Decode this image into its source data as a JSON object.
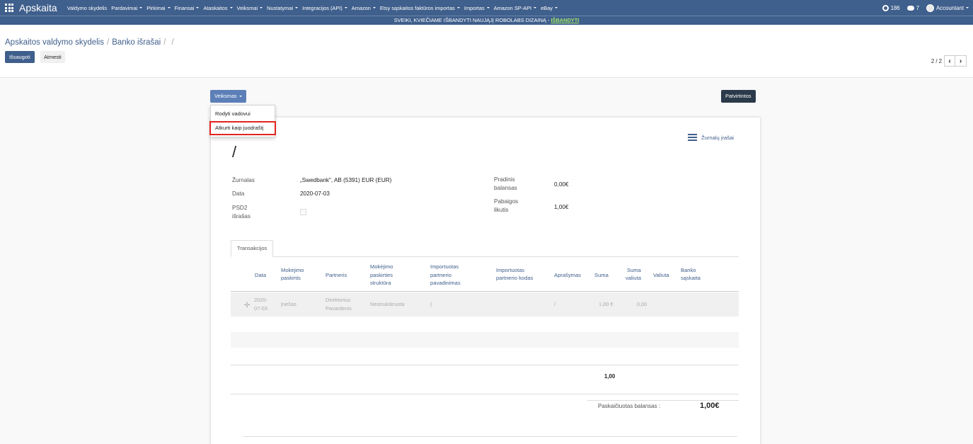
{
  "navbar": {
    "brand": "Apskaita",
    "menu": [
      {
        "label": "Valdymo skydelis",
        "dropdown": false
      },
      {
        "label": "Pardavimai",
        "dropdown": true
      },
      {
        "label": "Pirkimai",
        "dropdown": true
      },
      {
        "label": "Finansai",
        "dropdown": true
      },
      {
        "label": "Ataskaitos",
        "dropdown": true
      },
      {
        "label": "Veiksmai",
        "dropdown": true
      },
      {
        "label": "Nustatymai",
        "dropdown": true
      },
      {
        "label": "Integracijos (API)",
        "dropdown": true
      },
      {
        "label": "Amazon",
        "dropdown": true
      },
      {
        "label": "Etsy sąskaitos faktūros importas",
        "dropdown": true
      },
      {
        "label": "Importas",
        "dropdown": true
      },
      {
        "label": "Amazon SP-API",
        "dropdown": true
      },
      {
        "label": "eBay",
        "dropdown": true
      }
    ],
    "activity_count": "186",
    "message_count": "7",
    "user": "Accountant"
  },
  "banner": {
    "text": "SVEIKI, KVIEČIAME IŠBANDYTI NAUJĄJĮ ROBOLABS DIZAINĄ - ",
    "link": "IŠBANDYTI"
  },
  "breadcrumb": {
    "items": [
      "Apskaitos valdymo skydelis",
      "Banko išrašai"
    ],
    "separator": "/"
  },
  "buttons": {
    "save": "Išsaugoti",
    "discard": "Atmesti",
    "action": "Veiksmas",
    "confirmed": "Patvirtintos"
  },
  "pager": {
    "text": "2 / 2",
    "prev": "‹",
    "next": "›"
  },
  "dropdown": {
    "items": [
      "Rodyti vadovui",
      "Atkurti kaip juodraštį"
    ]
  },
  "sheet": {
    "journal_link": "Žurnalų įrašai",
    "title": "/",
    "fields": {
      "zurnalas_label": "Žurnalas",
      "zurnalas_value": "„Swedbank\", AB (5391) EUR (EUR)",
      "data_label": "Data",
      "data_value": "2020-07-03",
      "psd2_label_1": "PSD2",
      "psd2_label_2": "išrašas",
      "pradinis_label_1": "Pradinis",
      "pradinis_label_2": "balansas",
      "pradinis_value": "0,00€",
      "pabaigos_label_1": "Pabaigos",
      "pabaigos_label_2": "likutis",
      "pabaigos_value": "1,00€"
    },
    "tab": "Transakcijos",
    "columns": {
      "data": "Data",
      "paskirtis_1": "Mokėjimo",
      "paskirtis_2": "paskirtis",
      "partneris": "Partneris",
      "struktura_1": "Mokėjimo",
      "struktura_2": "paskirties",
      "struktura_3": "struktūra",
      "imp_pav_1": "Importuotas",
      "imp_pav_2": "partnerio",
      "imp_pav_3": "pavadinimas",
      "imp_kodas_1": "Importuotas",
      "imp_kodas_2": "partnerio kodas",
      "aprasymas": "Aprašymas",
      "suma": "Suma",
      "suma_valiuta_1": "Suma",
      "suma_valiuta_2": "valiuta",
      "valiuta": "Valiuta",
      "banko_1": "Banko",
      "banko_2": "sąskaita"
    },
    "row": {
      "date_1": "2020-",
      "date_2": "07-03",
      "paskirtis": "Įnešas",
      "partneris_1": "Direktorius",
      "partneris_2": "Pavardenis",
      "struktura": "Nestruktūruota",
      "imp_pav": "(",
      "aprasymas": "/",
      "suma": "1,00 €",
      "suma_valiuta": "0,00"
    },
    "total_sum": "1,00",
    "balance_label": "Paskaičiuotas balansas :",
    "balance_value": "1,00€"
  }
}
